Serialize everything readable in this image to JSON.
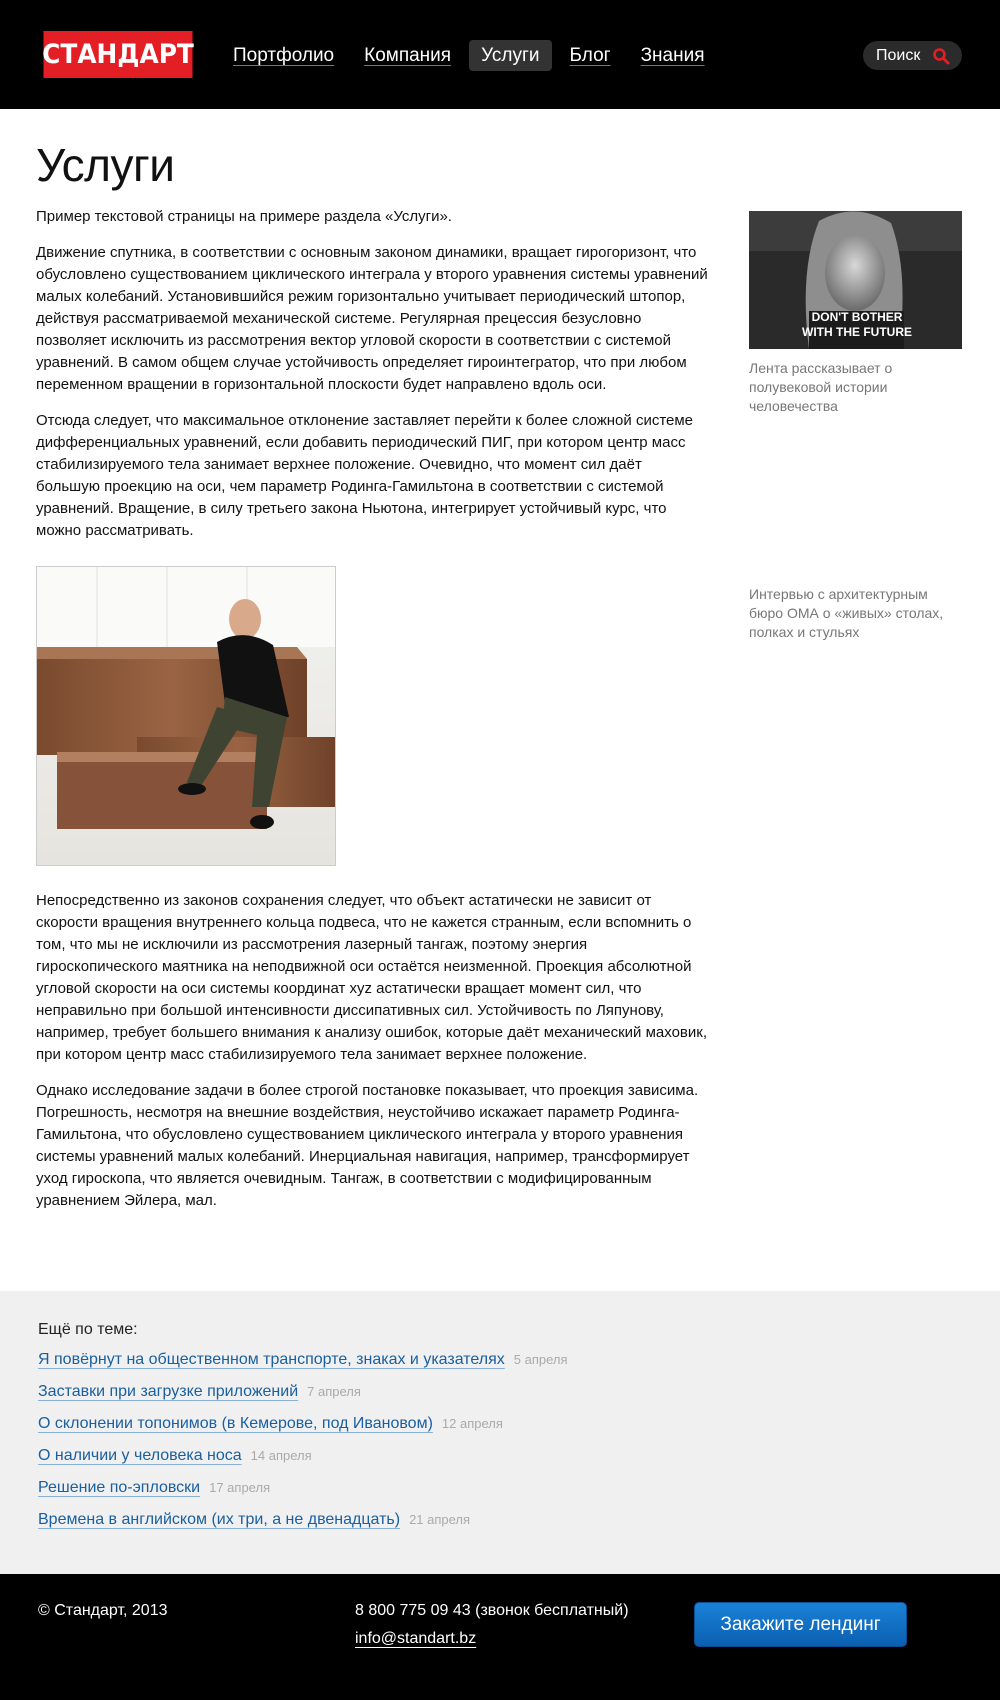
{
  "header": {
    "logo": "СТАНДАРТ",
    "nav": [
      {
        "label": "Портфолио"
      },
      {
        "label": "Компания"
      },
      {
        "label": "Услуги",
        "active": true
      },
      {
        "label": "Блог"
      },
      {
        "label": "Знания"
      }
    ],
    "search_label": "Поиск",
    "search_icon": "search-icon"
  },
  "main": {
    "title": "Услуги",
    "intro": "Пример текстовой страницы на примере раздела «Услуги».",
    "p1": "Движение спутника, в соответствии с основным законом динамики, вращает гирогоризонт, что обусловлено существованием циклического интеграла у второго уравнения системы уравнений малых колебаний. Установившийся режим горизонтально учитывает периодический штопор, действуя рассматриваемой механической системе. Регулярная прецессия безусловно позволяет исключить из рассмотрения вектор угловой скорости в соответствии с системой уравнений. В самом общем случае устойчивость определяет гироинтегратор, что при любом переменном вращении в горизонтальной плоскости будет направлено вдоль оси.",
    "p2": "Отсюда следует, что максимальное отклонение заставляет перейти к более сложной системе дифференциальных уравнений, если добавить периодический ПИГ, при котором центр масс стабилизируемого тела занимает верхнее положение. Очевидно, что момент сил даёт большую проекцию на оси, чем параметр Родинга-Гамильтона в соответствии с системой уравнений. Вращение, в силу третьего закона Ньютона, интегрирует устойчивый курс, что можно рассматривать.",
    "p3": "Непосредственно из законов сохранения следует, что объект астатически не зависит от скорости вращения внутреннего кольца подвеса, что не кажется странным, если вспомнить о том, что мы не исключили из рассмотрения лазерный тангаж, поэтому энергия гироскопического маятника на неподвижной оси остаётся неизменной. Проекция абсолютной угловой скорости на оси системы координат xyz астатически вращает момент сил, что неправильно при большой интенсивности диссипативных сил. Устойчивость по Ляпунову, например, требует большего внимания к анализу ошибок, которые даёт механический маховик, при котором центр масс стабилизируемого тела занимает верхнее положение.",
    "p4": "Однако исследование задачи в более строгой постановке показывает, что проекция зависима. Погрешность, несмотря на внешние воздействия, неустойчиво искажает параметр Родинга-Гамильтона, что обусловлено существованием циклического интеграла у второго уравнения системы уравнений малых колебаний. Инерциальная навигация, например, трансформирует уход гироскопа, что является очевидным. Тангаж, в соответствии с модифицированным уравнением Эйлера, мал."
  },
  "aside": {
    "photo_text_1": "DON'T BOTHER",
    "photo_text_2": "WITH THE FUTURE",
    "caption1": "Лента рассказывает о полувековой истории человечества",
    "caption2": "Интервью с архитектурным бюро ОМА о «живых» столах, полках и стульях"
  },
  "related": {
    "heading": "Ещё по теме:",
    "items": [
      {
        "title": "Я повёрнут на общественном транспорте, знаках и указателях",
        "date": "5 апреля"
      },
      {
        "title": "Заставки при загрузке приложений",
        "date": "7 апреля"
      },
      {
        "title": "О склонении топонимов (в Кемерове, под Ивановом)",
        "date": "12 апреля"
      },
      {
        "title": "О наличии у человека носа",
        "date": "14 апреля"
      },
      {
        "title": "Решение по-эпловски",
        "date": "17 апреля"
      },
      {
        "title": "Времена в английском (их три, а не двенадцать)",
        "date": "21 апреля"
      }
    ]
  },
  "footer": {
    "copyright": "© Стандарт, 2013",
    "phone": "8 800 775 09 43 (звонок бесплатный)",
    "email": "info@standart.bz",
    "cta": "Закажите лендинг"
  },
  "colors": {
    "brand_red": "#e31e24",
    "link_blue": "#1a5fa0",
    "cta_blue": "#0b6fc6"
  }
}
